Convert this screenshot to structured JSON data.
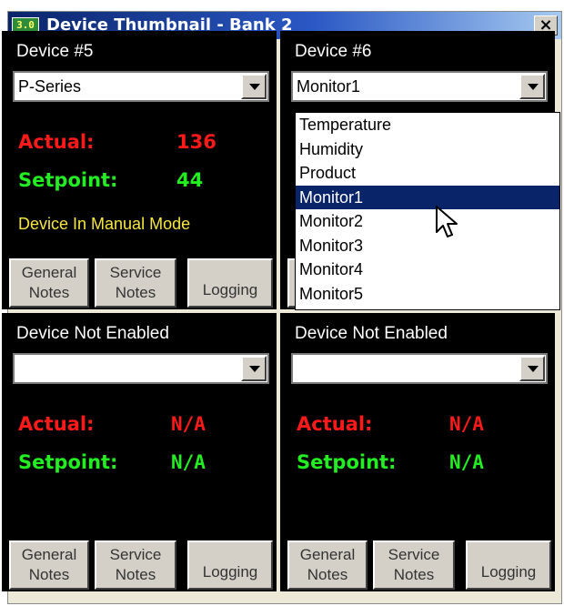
{
  "window": {
    "icon_text": "3.0",
    "title": "Device Thumbnail - Bank 2",
    "close_label": "×"
  },
  "panels": [
    {
      "device_title": "Device #5",
      "combo_value": "P-Series",
      "actual_label": "Actual:",
      "actual_value": "136",
      "setpoint_label": "Setpoint:",
      "setpoint_value": "44",
      "status_text": "Device In Manual Mode",
      "buttons": {
        "general_line1": "General",
        "general_line2": "Notes",
        "service_line1": "Service",
        "service_line2": "Notes",
        "logging": "Logging"
      }
    },
    {
      "device_title": "Device #6",
      "combo_value": "Monitor1",
      "dropdown_options": [
        "Temperature",
        "Humidity",
        "Product",
        "Monitor1",
        "Monitor2",
        "Monitor3",
        "Monitor4",
        "Monitor5"
      ],
      "dropdown_selected": "Monitor1"
    },
    {
      "device_title": "Device Not Enabled",
      "combo_value": "",
      "actual_label": "Actual:",
      "actual_value": "N/A",
      "setpoint_label": "Setpoint:",
      "setpoint_value": "N/A",
      "buttons": {
        "general_line1": "General",
        "general_line2": "Notes",
        "service_line1": "Service",
        "service_line2": "Notes",
        "logging": "Logging"
      }
    },
    {
      "device_title": "Device Not Enabled",
      "combo_value": "",
      "actual_label": "Actual:",
      "actual_value": "N/A",
      "setpoint_label": "Setpoint:",
      "setpoint_value": "N/A",
      "buttons": {
        "general_line1": "General",
        "general_line2": "Notes",
        "service_line1": "Service",
        "service_line2": "Notes",
        "logging": "Logging"
      }
    }
  ],
  "colors": {
    "actual": "#ff1a1a",
    "setpoint": "#22ee22",
    "status": "#f5e642",
    "selection": "#0a246a",
    "panel_bg": "#000000"
  },
  "icons": [
    "app-icon",
    "close-icon",
    "chevron-down-icon",
    "mouse-cursor-icon"
  ]
}
